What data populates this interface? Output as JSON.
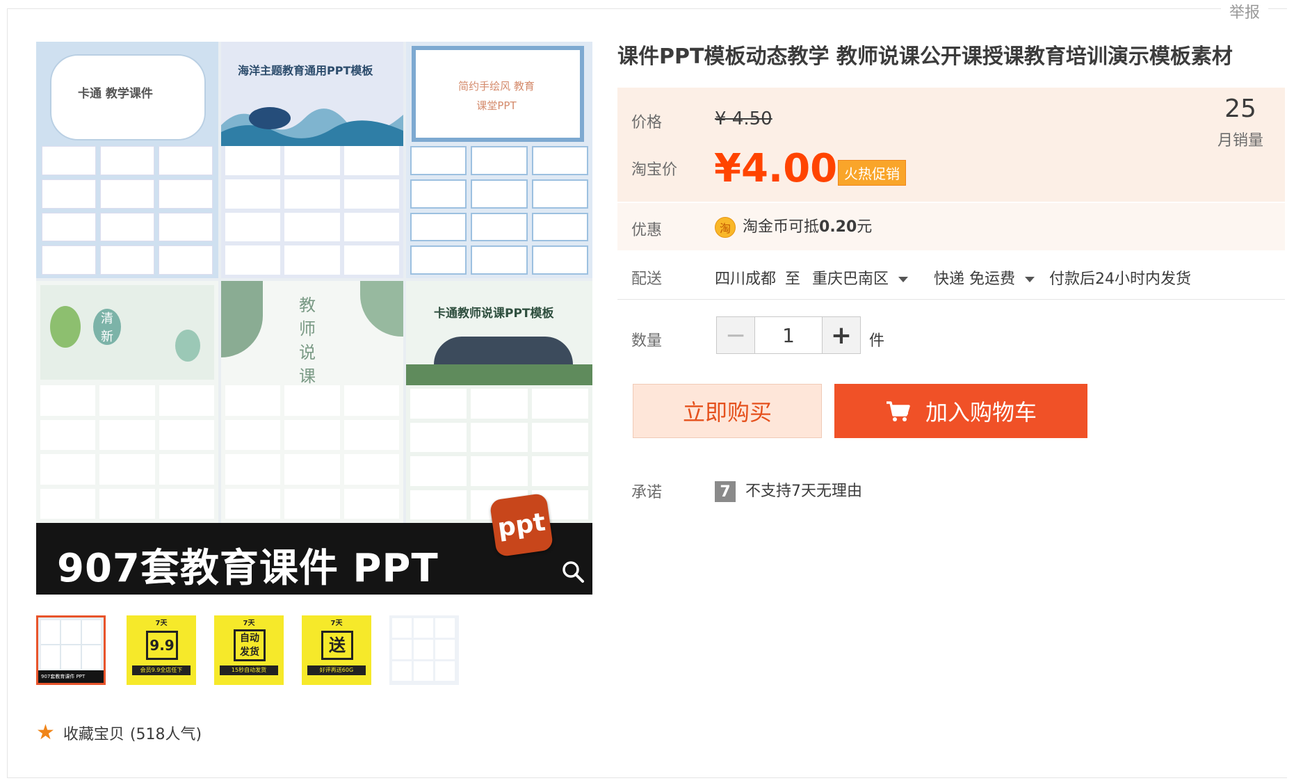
{
  "header": {
    "report_label": "举报"
  },
  "gallery": {
    "tiles": [
      {
        "title": "卡通 教学课件"
      },
      {
        "title": "海洋主题教育通用PPT模板"
      },
      {
        "title": "简约手绘风 教育课堂PPT"
      },
      {
        "title": "清 新"
      },
      {
        "title": "教 师 说 课"
      },
      {
        "title": "卡通教师说课PPT模板"
      }
    ],
    "banner_text": "907套教育课件 PPT",
    "logo_text": "ppt",
    "thumbs": [
      {
        "label": "907套教育课件 PPT"
      },
      {
        "top": "7天",
        "big": "9.9",
        "bottom": "会员9.9全店任下"
      },
      {
        "top": "7天",
        "big": "自动发货",
        "bottom": "15秒自动发货"
      },
      {
        "top": "7天",
        "big": "送",
        "bottom": "好评再送60G"
      },
      {
        "label": ""
      }
    ]
  },
  "favorite": {
    "label": "收藏宝贝",
    "count": "(518人气)"
  },
  "product": {
    "title": "课件PPT模板动态教学 教师说课公开课授课教育培训演示模板素材",
    "price_label": "价格",
    "original_price": "¥ 4.50",
    "taobao_price_label": "淘宝价",
    "current_price": "¥4.00",
    "promo_tag": "火热促销",
    "monthly_sales": "25",
    "monthly_sales_label": "月销量",
    "discount_label": "优惠",
    "coin_icon_text": "淘",
    "discount_text_a": "淘金币可抵",
    "discount_amount": "0.20",
    "discount_text_b": "元",
    "delivery_label": "配送",
    "origin": "四川成都",
    "to": "至",
    "destination": "重庆巴南区",
    "shipping": "快递 免运费",
    "dispatch": "付款后24小时内发货",
    "quantity_label": "数量",
    "quantity": "1",
    "unit": "件",
    "buy_now": "立即购买",
    "add_to_cart": "加入购物车",
    "promise_label": "承诺",
    "promise_badge": "7",
    "promise_text": "不支持7天无理由"
  },
  "colors": {
    "accent": "#f05127",
    "price": "#ff4400",
    "tag": "#f9a52a"
  }
}
